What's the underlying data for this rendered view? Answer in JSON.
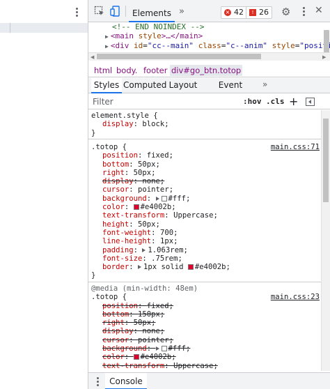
{
  "toolbar": {
    "elements_tab": "Elements",
    "more_tabs": "»",
    "error_count": "42",
    "issue_count": "26",
    "close": "✕"
  },
  "dom_tree": {
    "line1": "<!-- END NOINDEX -->",
    "line2_tag_open": "<main",
    "line2_attr": "style",
    "line2_rest": ">…</main>",
    "line3_tag_open": "<div",
    "line3_attr1_name": "id",
    "line3_attr1_value": "\"cc--main\"",
    "line3_attr2_name": "class",
    "line3_attr2_value": "\"c--anim\"",
    "line3_attr3_name": "style",
    "line3_attr3_value": "\"position:"
  },
  "breadcrumb": [
    "html",
    "body.",
    "footer",
    "div#go_btn.totop"
  ],
  "sub_tabs": {
    "styles": "Styles",
    "computed": "Computed",
    "layout": "Layout",
    "event_listeners": "Event Listeners",
    "more": "»"
  },
  "filter": {
    "placeholder": "Filter",
    "hov": ":hov",
    "cls": ".cls",
    "plus": "+"
  },
  "styles": {
    "element_style": {
      "selector": "element.style {",
      "prop": "display",
      "value": "block;",
      "close": "}"
    },
    "totop_rule": {
      "selector": ".totop {",
      "source": "main.css:71",
      "props": [
        {
          "name": "position",
          "value": "fixed;",
          "struck": false
        },
        {
          "name": "bottom",
          "value": "50px;",
          "struck": false
        },
        {
          "name": "right",
          "value": "50px;",
          "struck": false
        },
        {
          "name": "display",
          "value": "none;",
          "struck": true
        },
        {
          "name": "cursor",
          "value": "pointer;",
          "struck": false
        },
        {
          "name": "background",
          "value": "#fff;",
          "struck": false
        },
        {
          "name": "color",
          "value": "#e4002b;",
          "struck": false
        },
        {
          "name": "text-transform",
          "value": "Uppercase;",
          "struck": false
        },
        {
          "name": "height",
          "value": "50px;",
          "struck": false
        },
        {
          "name": "font-weight",
          "value": "700;",
          "struck": false
        },
        {
          "name": "line-height",
          "value": "1px;",
          "struck": false
        },
        {
          "name": "padding",
          "value": "1.063rem;",
          "struck": false
        },
        {
          "name": "font-size",
          "value": ".75rem;",
          "struck": false
        },
        {
          "name": "border",
          "value": "1px solid",
          "value2": "#e4002b;",
          "struck": false
        }
      ],
      "close": "}"
    },
    "media_rule": {
      "media": "@media (min-width: 48em)",
      "selector": ".totop {",
      "source": "main.css:23",
      "props": [
        {
          "name": "position",
          "value": "fixed;"
        },
        {
          "name": "bottom",
          "value": "150px;"
        },
        {
          "name": "right",
          "value": "50px;"
        },
        {
          "name": "display",
          "value": "none;"
        },
        {
          "name": "cursor",
          "value": "pointer;"
        },
        {
          "name": "background",
          "value": "#fff;"
        },
        {
          "name": "color",
          "value": "#e4002b;"
        },
        {
          "name": "text-transform",
          "value": "Uppercase;"
        }
      ]
    }
  },
  "colors": {
    "white_swatch": "#ffffff",
    "red_swatch": "#e4002b",
    "accent": "#1a73e8"
  },
  "console": {
    "tab": "Console"
  }
}
